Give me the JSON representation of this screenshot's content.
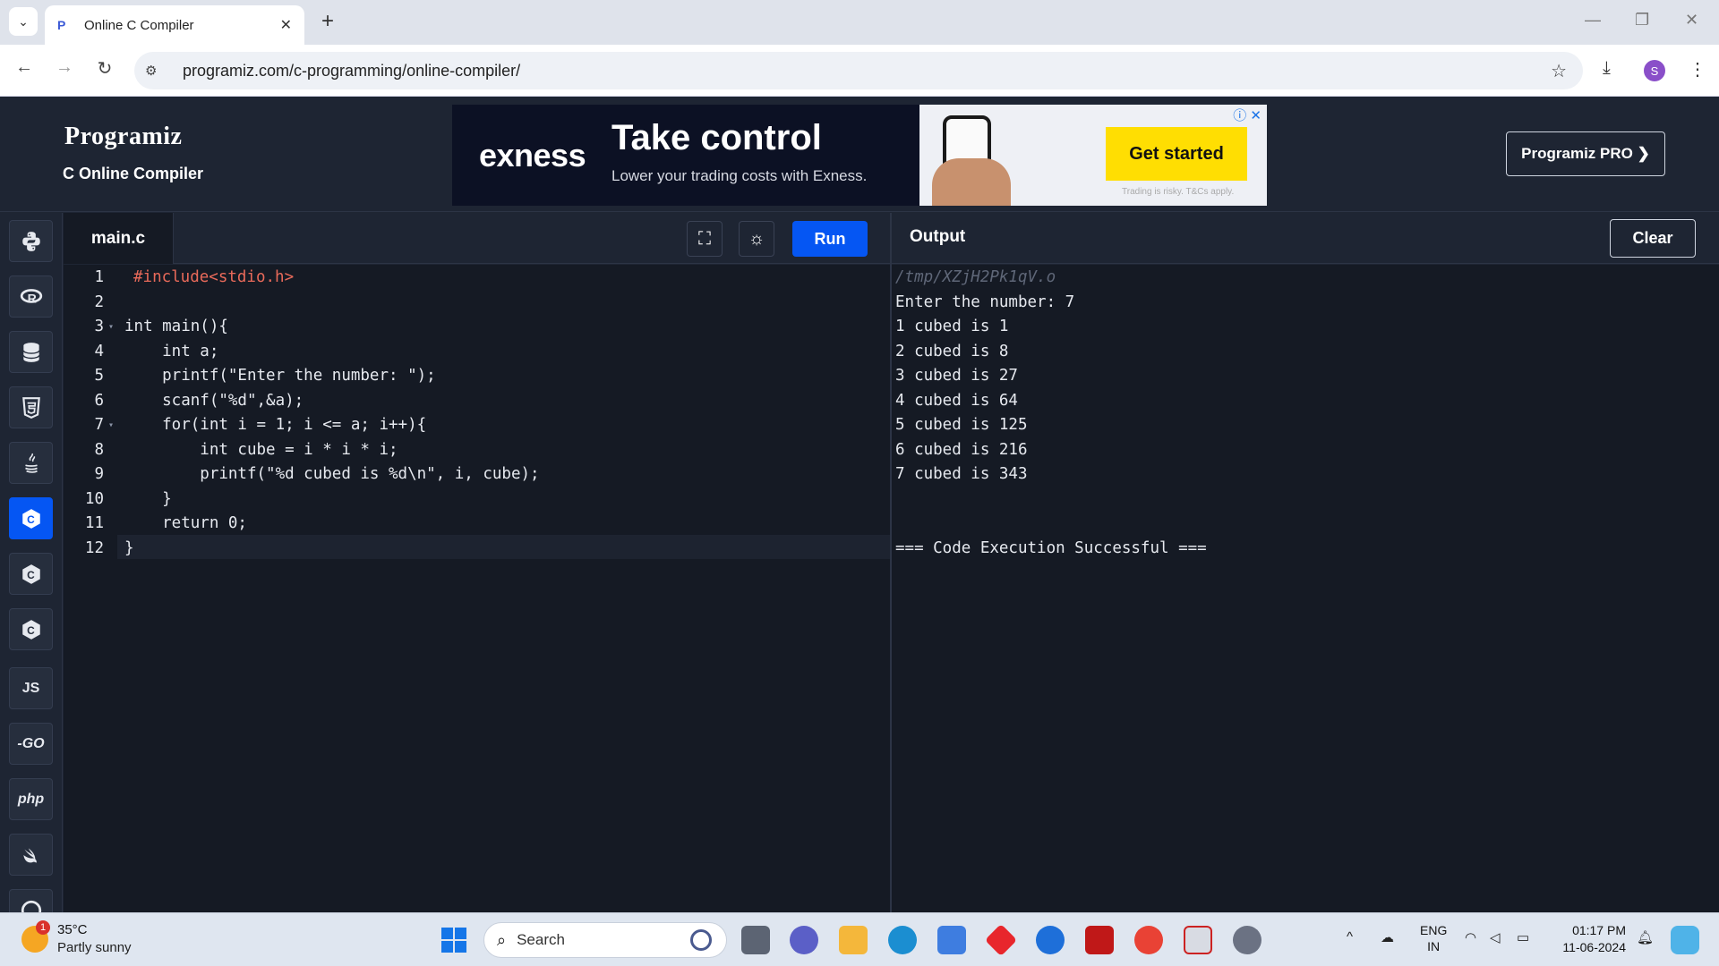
{
  "browser": {
    "tab_title": "Online C Compiler",
    "tab_close": "✕",
    "new_tab": "+",
    "url": "programiz.com/c-programming/online-compiler/"
  },
  "header": {
    "logo": "Programiz",
    "subtitle": "C Online Compiler",
    "pro_button": "Programiz PRO ❯"
  },
  "ad": {
    "brand": "exness",
    "headline": "Take control",
    "subline": "Lower your trading costs with Exness.",
    "cta": "Get started",
    "disclaimer": "Trading is risky. T&Cs apply."
  },
  "languages": [
    {
      "name": "python",
      "label": ""
    },
    {
      "name": "r",
      "label": ""
    },
    {
      "name": "sql",
      "label": ""
    },
    {
      "name": "html",
      "label": ""
    },
    {
      "name": "java",
      "label": ""
    },
    {
      "name": "c",
      "label": ""
    },
    {
      "name": "cpp",
      "label": ""
    },
    {
      "name": "csharp",
      "label": ""
    },
    {
      "name": "js",
      "label": "JS"
    },
    {
      "name": "go",
      "label": "-GO"
    },
    {
      "name": "php",
      "label": "php"
    },
    {
      "name": "swift",
      "label": ""
    },
    {
      "name": "rust",
      "label": ""
    }
  ],
  "editor": {
    "filename": "main.c",
    "run_label": "Run",
    "line_numbers": [
      "1",
      "2",
      "3",
      "4",
      "5",
      "6",
      "7",
      "8",
      "9",
      "10",
      "11",
      "12"
    ],
    "code_lines": [
      "#include<stdio.h>",
      "",
      "int main(){",
      "    int a;",
      "    printf(\"Enter the number: \");",
      "    scanf(\"%d\",&a);",
      "    for(int i = 1; i <= a; i++){",
      "        int cube = i * i * i;",
      "        printf(\"%d cubed is %d\\n\", i, cube);",
      "    }",
      "    return 0;",
      "}"
    ]
  },
  "output": {
    "title": "Output",
    "clear_label": "Clear",
    "path": "/tmp/XZjH2Pk1qV.o",
    "lines": [
      "Enter the number: 7",
      "1 cubed is 1",
      "2 cubed is 8",
      "3 cubed is 27",
      "4 cubed is 64",
      "5 cubed is 125",
      "6 cubed is 216",
      "7 cubed is 343",
      "",
      "",
      "=== Code Execution Successful ==="
    ]
  },
  "taskbar": {
    "weather_temp": "35°C",
    "weather_desc": "Partly sunny",
    "weather_badge": "1",
    "search_placeholder": "Search",
    "lang_line1": "ENG",
    "lang_line2": "IN",
    "time": "01:17 PM",
    "date": "11-06-2024"
  },
  "colors": {
    "accent": "#0556f3",
    "background": "#1e2533",
    "editor_bg": "#151a24"
  }
}
